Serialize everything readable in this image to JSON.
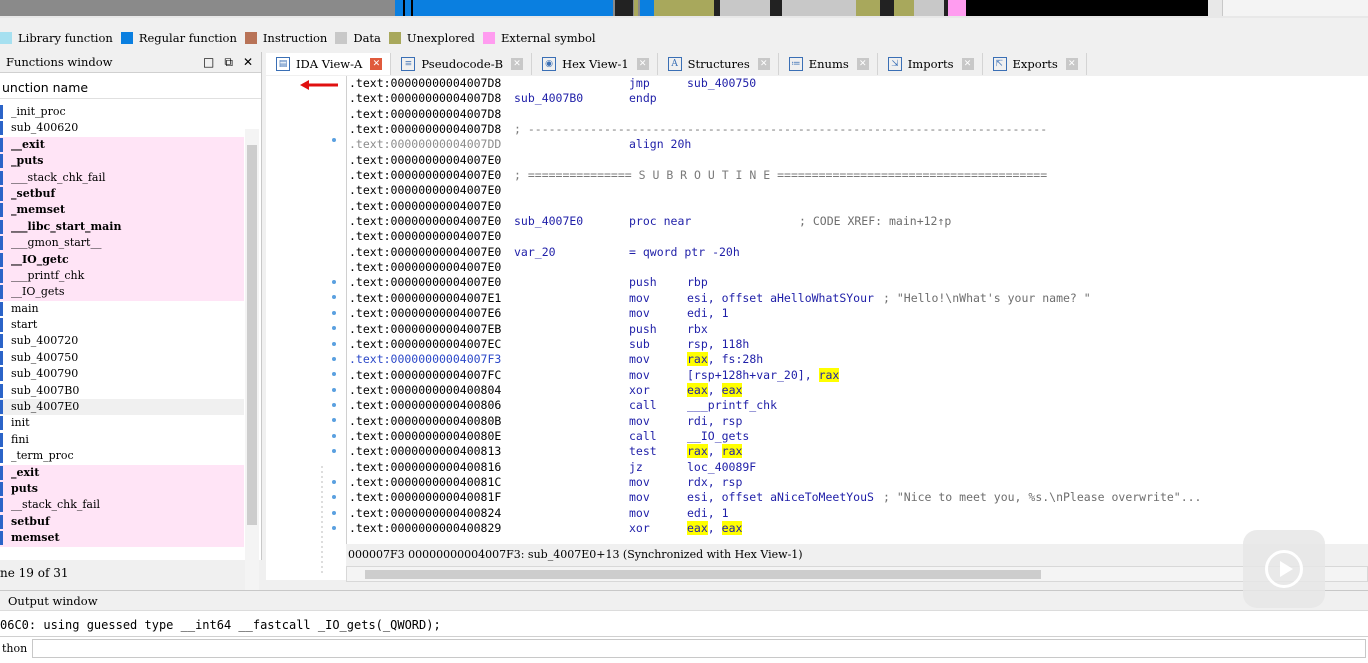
{
  "legend": [
    {
      "label": "Library function",
      "color": "#a6e0f0"
    },
    {
      "label": "Regular function",
      "color": "#0a7fe0"
    },
    {
      "label": "Instruction",
      "color": "#b87357"
    },
    {
      "label": "Data",
      "color": "#c8c8c8"
    },
    {
      "label": "Unexplored",
      "color": "#a8a85c"
    },
    {
      "label": "External symbol",
      "color": "#ff9cf0"
    }
  ],
  "functions_window": {
    "title": "Functions window",
    "column_header": "unction name",
    "items": [
      {
        "name": "_init_proc",
        "lib": false,
        "bold": false
      },
      {
        "name": "sub_400620",
        "lib": false,
        "bold": false
      },
      {
        "name": "__exit",
        "lib": true,
        "bold": true
      },
      {
        "name": "_puts",
        "lib": true,
        "bold": true
      },
      {
        "name": "___stack_chk_fail",
        "lib": true,
        "bold": false
      },
      {
        "name": "_setbuf",
        "lib": true,
        "bold": true
      },
      {
        "name": "_memset",
        "lib": true,
        "bold": true
      },
      {
        "name": "___libc_start_main",
        "lib": true,
        "bold": true
      },
      {
        "name": "___gmon_start__",
        "lib": true,
        "bold": false
      },
      {
        "name": "__IO_getc",
        "lib": true,
        "bold": true
      },
      {
        "name": "___printf_chk",
        "lib": true,
        "bold": false
      },
      {
        "name": "__IO_gets",
        "lib": true,
        "bold": false
      },
      {
        "name": "main",
        "lib": false,
        "bold": false
      },
      {
        "name": "start",
        "lib": false,
        "bold": false
      },
      {
        "name": "sub_400720",
        "lib": false,
        "bold": false
      },
      {
        "name": "sub_400750",
        "lib": false,
        "bold": false
      },
      {
        "name": "sub_400790",
        "lib": false,
        "bold": false
      },
      {
        "name": "sub_4007B0",
        "lib": false,
        "bold": false
      },
      {
        "name": "sub_4007E0",
        "lib": false,
        "bold": false,
        "selected": true
      },
      {
        "name": "init",
        "lib": false,
        "bold": false
      },
      {
        "name": "fini",
        "lib": false,
        "bold": false
      },
      {
        "name": "_term_proc",
        "lib": false,
        "bold": false
      },
      {
        "name": "_exit",
        "lib": true,
        "bold": true
      },
      {
        "name": "puts",
        "lib": true,
        "bold": true
      },
      {
        "name": "__stack_chk_fail",
        "lib": true,
        "bold": false
      },
      {
        "name": "setbuf",
        "lib": true,
        "bold": true
      },
      {
        "name": "memset",
        "lib": true,
        "bold": true
      }
    ],
    "line_count": "ne 19 of 31"
  },
  "tabs": [
    {
      "label": "IDA View-A",
      "icon": "ida-view-icon",
      "active": true
    },
    {
      "label": "Pseudocode-B",
      "icon": "pseudocode-icon",
      "active": false
    },
    {
      "label": "Hex View-1",
      "icon": "hex-view-icon",
      "active": false
    },
    {
      "label": "Structures",
      "icon": "structures-icon",
      "active": false
    },
    {
      "label": "Enums",
      "icon": "enums-icon",
      "active": false
    },
    {
      "label": "Imports",
      "icon": "imports-icon",
      "active": false
    },
    {
      "label": "Exports",
      "icon": "exports-icon",
      "active": false
    }
  ],
  "disasm": [
    {
      "addr": ".text:00000000004007D8",
      "mn": "jmp",
      "op": "sub_400750"
    },
    {
      "addr": ".text:00000000004007D8",
      "label": "sub_4007B0",
      "mn": "endp"
    },
    {
      "addr": ".text:00000000004007D8"
    },
    {
      "addr": ".text:00000000004007D8",
      "sep": "; ---------------------------------------------------------------------------"
    },
    {
      "addr": ".text:00000000004007DD",
      "grey": true,
      "mn": "align 20h"
    },
    {
      "addr": ".text:00000000004007E0"
    },
    {
      "addr": ".text:00000000004007E0",
      "sep": "; =============== S U B R O U T I N E ======================================="
    },
    {
      "addr": ".text:00000000004007E0"
    },
    {
      "addr": ".text:00000000004007E0"
    },
    {
      "addr": ".text:00000000004007E0",
      "label": "sub_4007E0",
      "mn": "proc near",
      "cm": "; CODE XREF: main+12↑p"
    },
    {
      "addr": ".text:00000000004007E0"
    },
    {
      "addr": ".text:00000000004007E0",
      "label": "var_20",
      "mn": "= qword ptr -20h"
    },
    {
      "addr": ".text:00000000004007E0"
    },
    {
      "addr": ".text:00000000004007E0",
      "mn": "push",
      "op": "rbp"
    },
    {
      "addr": ".text:00000000004007E1",
      "mn": "mov",
      "op": "esi, offset aHelloWhatSYour",
      "cm": "; \"Hello!\\nWhat's your name? \""
    },
    {
      "addr": ".text:00000000004007E6",
      "mn": "mov",
      "op": "edi, 1"
    },
    {
      "addr": ".text:00000000004007EB",
      "mn": "push",
      "op": "rbx"
    },
    {
      "addr": ".text:00000000004007EC",
      "mn": "sub",
      "op": "rsp, 118h"
    },
    {
      "addr": ".text:00000000004007F3",
      "blue": true,
      "mn": "mov",
      "op_hl": "rax",
      "op_rest": ", fs:28h"
    },
    {
      "addr": ".text:00000000004007FC",
      "mn": "mov",
      "op": "[rsp+128h+var_20], ",
      "op_tail_hl": "rax"
    },
    {
      "addr": ".text:0000000000400804",
      "mn": "xor",
      "op_hl": "eax",
      "op_rest": ", ",
      "op_tail_hl": "eax"
    },
    {
      "addr": ".text:0000000000400806",
      "mn": "call",
      "op": "___printf_chk"
    },
    {
      "addr": ".text:000000000040080B",
      "mn": "mov",
      "op": "rdi, rsp"
    },
    {
      "addr": ".text:000000000040080E",
      "mn": "call",
      "op": "__IO_gets"
    },
    {
      "addr": ".text:0000000000400813",
      "mn": "test",
      "op_hl": "rax",
      "op_rest": ", ",
      "op_tail_hl": "rax"
    },
    {
      "addr": ".text:0000000000400816",
      "mn": "jz",
      "op": "loc_40089F"
    },
    {
      "addr": ".text:000000000040081C",
      "mn": "mov",
      "op": "rdx, rsp"
    },
    {
      "addr": ".text:000000000040081F",
      "mn": "mov",
      "op": "esi, offset aNiceToMeetYouS",
      "cm": "; \"Nice to meet you, %s.\\nPlease overwrite\"..."
    },
    {
      "addr": ".text:0000000000400824",
      "mn": "mov",
      "op": "edi, 1"
    },
    {
      "addr": ".text:0000000000400829",
      "mn": "xor",
      "op_hl": "eax",
      "op_rest": ", ",
      "op_tail_hl": "eax"
    }
  ],
  "sync_text": "000007F3 00000000004007F3: sub_4007E0+13 (Synchronized with Hex View-1)",
  "output": {
    "title": "Output window",
    "line": "06C0: using guessed type __int64 __fastcall _IO_gets(_QWORD);",
    "lang": "thon"
  }
}
